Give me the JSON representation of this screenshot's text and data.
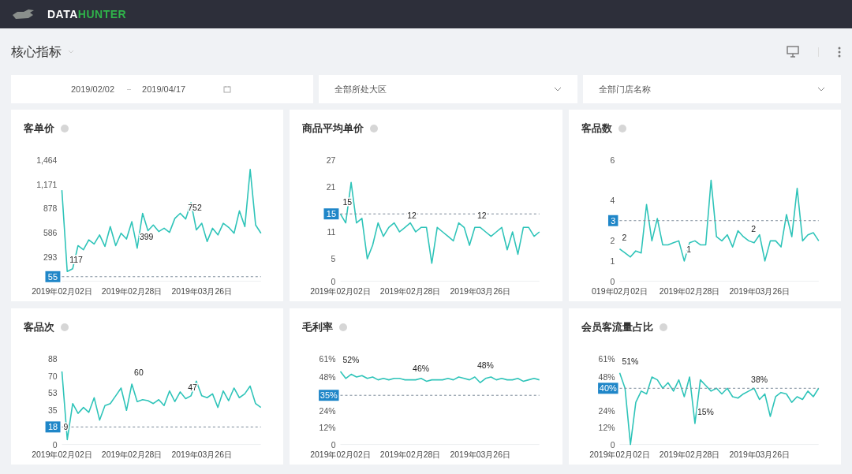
{
  "header": {
    "logo_text_1": "DATA",
    "logo_text_2": "HUNTER"
  },
  "page": {
    "title": "核心指标"
  },
  "filters": {
    "date_start": "2019/02/02",
    "date_end": "2019/04/17",
    "region": "全部所处大区",
    "store": "全部门店名称"
  },
  "cards": [
    {
      "title": "客单价",
      "chart_data": {
        "type": "line",
        "categories": [
          "2019年02月02日",
          null,
          null,
          null,
          null,
          null,
          null,
          null,
          null,
          null,
          null,
          null,
          null,
          "2019年02月28日",
          null,
          null,
          null,
          null,
          null,
          null,
          null,
          null,
          null,
          null,
          null,
          null,
          "2019年03月26日",
          null,
          null,
          null,
          null,
          null,
          null,
          null,
          null,
          null,
          null,
          null
        ],
        "ylim": [
          0,
          1464
        ],
        "yticks": [
          {
            "value": 293,
            "label": "293"
          },
          {
            "value": 586,
            "label": "586"
          },
          {
            "value": 878,
            "label": "878"
          },
          {
            "value": 1171,
            "label": "1,171"
          },
          {
            "value": 1464,
            "label": "1,464"
          }
        ],
        "series": [
          {
            "color": "#2fc4b9",
            "values": [
              1100,
              117,
              150,
              430,
              380,
              500,
              450,
              560,
              420,
              660,
              430,
              580,
              510,
              720,
              399,
              820,
              610,
              680,
              600,
              640,
              590,
              760,
              820,
              752,
              950,
              620,
              700,
              480,
              640,
              560,
              700,
              650,
              580,
              850,
              660,
              1350,
              680,
              580
            ]
          }
        ],
        "value_labels": [
          null,
          "117",
          null,
          null,
          null,
          null,
          null,
          null,
          null,
          null,
          null,
          null,
          null,
          null,
          "399",
          null,
          null,
          null,
          null,
          null,
          null,
          null,
          null,
          "752",
          null,
          null,
          null,
          null,
          null,
          null,
          null,
          null,
          null,
          null,
          null,
          null,
          null,
          null
        ],
        "ref_lines": [
          {
            "axis": "y",
            "value": 55,
            "label": "55"
          }
        ]
      }
    },
    {
      "title": "商品平均单价",
      "chart_data": {
        "type": "line",
        "categories": [
          "2019年02月02日",
          null,
          null,
          null,
          null,
          null,
          null,
          null,
          null,
          null,
          null,
          null,
          null,
          "2019年02月28日",
          null,
          null,
          null,
          null,
          null,
          null,
          null,
          null,
          null,
          null,
          null,
          null,
          "2019年03月26日",
          null,
          null,
          null,
          null,
          null,
          null,
          null,
          null,
          null,
          null,
          null
        ],
        "ylim": [
          0,
          27
        ],
        "yticks": [
          0,
          5,
          11,
          21,
          27
        ],
        "series": [
          {
            "color": "#2fc4b9",
            "values": [
              15,
              13,
              22,
              13,
              14,
              5,
              8,
              13,
              10,
              12,
              13,
              11,
              12,
              13,
              11,
              12,
              12,
              4,
              12,
              11,
              10,
              9,
              13,
              12,
              8,
              12,
              12,
              11,
              10,
              11,
              12,
              7,
              11,
              6,
              12,
              12,
              10,
              11
            ]
          }
        ],
        "value_labels": [
          "15",
          null,
          null,
          null,
          null,
          null,
          null,
          null,
          null,
          null,
          null,
          null,
          "12",
          null,
          null,
          null,
          null,
          null,
          null,
          null,
          null,
          null,
          null,
          null,
          null,
          "12",
          null,
          null,
          null,
          null,
          null,
          null,
          null,
          null,
          null,
          null,
          null,
          null
        ],
        "ref_lines": [
          {
            "axis": "y",
            "value": 15,
            "label": "15"
          }
        ]
      }
    },
    {
      "title": "客品数",
      "chart_data": {
        "type": "line",
        "categories": [
          "019年02月02日",
          null,
          null,
          null,
          null,
          null,
          null,
          null,
          null,
          null,
          null,
          null,
          null,
          "2019年02月28日",
          null,
          null,
          null,
          null,
          null,
          null,
          null,
          null,
          null,
          null,
          null,
          null,
          "2019年03月26日",
          null,
          null,
          null,
          null,
          null,
          null,
          null,
          null,
          null,
          null,
          null
        ],
        "ylim": [
          0,
          6
        ],
        "yticks": [
          0,
          1,
          2,
          4,
          6
        ],
        "series": [
          {
            "color": "#2fc4b9",
            "values": [
              1.6,
              1.4,
              1.2,
              1.5,
              1.4,
              3.8,
              2,
              3.1,
              1.8,
              1.8,
              1.9,
              2,
              1,
              1.9,
              2,
              1.8,
              1.8,
              5,
              2.2,
              2,
              2.3,
              1.7,
              2.5,
              2.2,
              2,
              1.9,
              2.3,
              1,
              2,
              2,
              1.7,
              3.3,
              2.2,
              4.6,
              2,
              2.3,
              2.4,
              2
            ]
          }
        ],
        "value_labels": [
          "2",
          null,
          null,
          null,
          null,
          null,
          null,
          null,
          null,
          null,
          null,
          null,
          "1",
          null,
          null,
          null,
          null,
          null,
          null,
          null,
          null,
          null,
          null,
          null,
          "2",
          null,
          null,
          null,
          null,
          null,
          null,
          null,
          null,
          null,
          null,
          null,
          null,
          null
        ],
        "ref_lines": [
          {
            "axis": "y",
            "value": 3,
            "label": "3"
          }
        ]
      }
    },
    {
      "title": "客品次",
      "chart_data": {
        "type": "line",
        "categories": [
          "2019年02月02日",
          null,
          null,
          null,
          null,
          null,
          null,
          null,
          null,
          null,
          null,
          null,
          null,
          "2019年02月28日",
          null,
          null,
          null,
          null,
          null,
          null,
          null,
          null,
          null,
          null,
          null,
          null,
          "2019年03月26日",
          null,
          null,
          null,
          null,
          null,
          null,
          null,
          null,
          null,
          null,
          null
        ],
        "ylim": [
          0,
          88
        ],
        "yticks": [
          0,
          35,
          53,
          70,
          88
        ],
        "series": [
          {
            "color": "#2fc4b9",
            "values": [
              75,
              5,
              42,
              32,
              38,
              33,
              48,
              25,
              40,
              42,
              50,
              58,
              35,
              62,
              44,
              46,
              45,
              42,
              46,
              40,
              55,
              44,
              54,
              47,
              50,
              65,
              50,
              48,
              52,
              38,
              55,
              45,
              58,
              48,
              52,
              60,
              42,
              38
            ]
          }
        ],
        "value_labels": [
          null,
          null,
          null,
          null,
          null,
          null,
          null,
          null,
          null,
          null,
          null,
          null,
          null,
          "60",
          null,
          null,
          null,
          null,
          null,
          null,
          null,
          null,
          null,
          "47",
          null,
          null,
          null,
          null,
          null,
          null,
          null,
          null,
          null,
          null,
          null,
          null,
          null,
          null
        ],
        "annotations": [
          {
            "text": "9"
          }
        ],
        "ref_lines": [
          {
            "axis": "y",
            "value": 18,
            "label": "18"
          }
        ]
      }
    },
    {
      "title": "毛利率",
      "chart_data": {
        "type": "line",
        "categories": [
          "2019年02月02日",
          null,
          null,
          null,
          null,
          null,
          null,
          null,
          null,
          null,
          null,
          null,
          null,
          "2019年02月28日",
          null,
          null,
          null,
          null,
          null,
          null,
          null,
          null,
          null,
          null,
          null,
          null,
          "2019年03月26日",
          null,
          null,
          null,
          null,
          null,
          null,
          null,
          null,
          null,
          null,
          null
        ],
        "ylim": [
          0,
          61
        ],
        "yticks": [
          {
            "value": 0,
            "label": "0"
          },
          {
            "value": 12,
            "label": "12%"
          },
          {
            "value": 24,
            "label": "24%"
          },
          {
            "value": 48,
            "label": "48%"
          },
          {
            "value": 61,
            "label": "61%"
          }
        ],
        "series": [
          {
            "color": "#2fc4b9",
            "values": [
              52,
              47,
              50,
              48,
              49,
              47,
              48,
              46,
              47,
              46,
              47,
              47,
              46,
              46,
              46,
              47,
              45,
              46,
              46,
              46,
              47,
              46,
              48,
              47,
              46,
              48,
              44,
              47,
              48,
              46,
              47,
              46,
              46,
              47,
              45,
              46,
              47,
              46
            ]
          }
        ],
        "value_labels": [
          "52%",
          null,
          null,
          null,
          null,
          null,
          null,
          null,
          null,
          null,
          null,
          null,
          null,
          "46%",
          null,
          null,
          null,
          null,
          null,
          null,
          null,
          null,
          null,
          null,
          null,
          "48%",
          null,
          null,
          null,
          null,
          null,
          null,
          null,
          null,
          null,
          null,
          null,
          null
        ],
        "ref_lines": [
          {
            "axis": "y",
            "value": 35,
            "label": "35%"
          }
        ]
      }
    },
    {
      "title": "会员客流量占比",
      "chart_data": {
        "type": "line",
        "categories": [
          "2019年02月02日",
          null,
          null,
          null,
          null,
          null,
          null,
          null,
          null,
          null,
          null,
          null,
          null,
          "2019年02月28日",
          null,
          null,
          null,
          null,
          null,
          null,
          null,
          null,
          null,
          null,
          null,
          null,
          "2019年03月26日",
          null,
          null,
          null,
          null,
          null,
          null,
          null,
          null,
          null,
          null,
          null
        ],
        "ylim": [
          0,
          61
        ],
        "yticks": [
          {
            "value": 0,
            "label": "0"
          },
          {
            "value": 12,
            "label": "12%"
          },
          {
            "value": 24,
            "label": "24%"
          },
          {
            "value": 48,
            "label": "48%"
          },
          {
            "value": 61,
            "label": "61%"
          }
        ],
        "series": [
          {
            "color": "#2fc4b9",
            "values": [
              51,
              40,
              0,
              30,
              38,
              36,
              48,
              46,
              40,
              44,
              38,
              46,
              34,
              48,
              15,
              46,
              42,
              38,
              40,
              36,
              40,
              34,
              33,
              36,
              38,
              40,
              32,
              36,
              20,
              34,
              37,
              36,
              30,
              34,
              32,
              38,
              34,
              40
            ]
          }
        ],
        "value_labels": [
          "51%",
          null,
          null,
          null,
          null,
          null,
          null,
          null,
          null,
          null,
          null,
          null,
          null,
          null,
          "15%",
          null,
          null,
          null,
          null,
          null,
          null,
          null,
          null,
          null,
          "38%",
          null,
          null,
          null,
          null,
          null,
          null,
          null,
          null,
          null,
          null,
          null,
          null,
          null
        ],
        "ref_lines": [
          {
            "axis": "y",
            "value": 40,
            "label": "40%"
          }
        ]
      }
    }
  ]
}
